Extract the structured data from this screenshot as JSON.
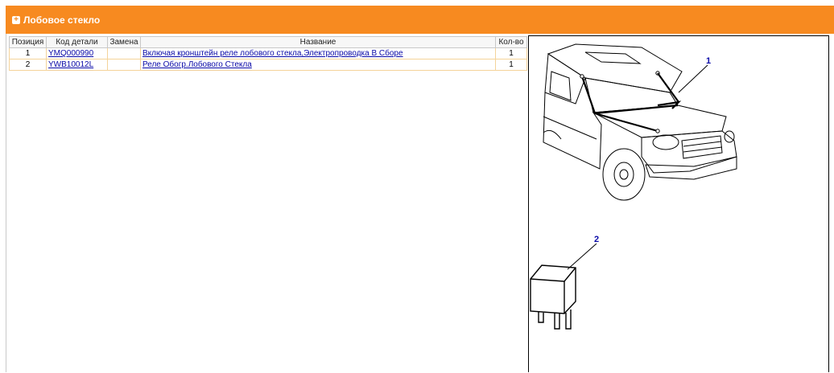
{
  "header": {
    "title": "Лобовое стекло",
    "icon": "plus-square-icon"
  },
  "table": {
    "columns": [
      "Позиция",
      "Код детали",
      "Замена",
      "Название",
      "Кол-во"
    ],
    "rows": [
      {
        "position": "1",
        "code": "YMQ000990",
        "replacement": "",
        "name": "Включая кронштейн реле лобового стекла,Электропроводка В Сборе",
        "qty": "1"
      },
      {
        "position": "2",
        "code": "YWB10012L",
        "replacement": "",
        "name": "Реле Обогр.Лобового Стекла",
        "qty": "1"
      }
    ]
  },
  "diagram": {
    "callouts": [
      "1",
      "2"
    ]
  },
  "colors": {
    "accent": "#f78a20",
    "link": "#0a0aa8",
    "row_border": "#f4d39a"
  }
}
